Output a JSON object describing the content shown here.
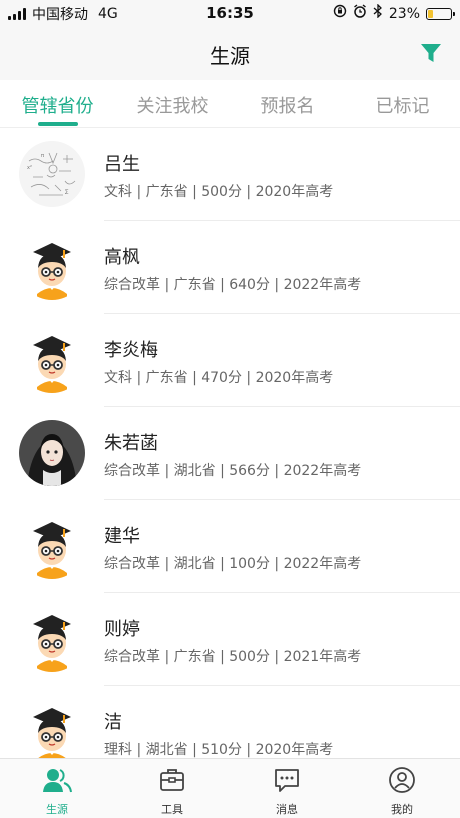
{
  "status_bar": {
    "carrier": "中国移动",
    "network": "4G",
    "time": "16:35",
    "battery_text": "23%",
    "battery_level": 0.23,
    "icons": [
      "rotation-lock-icon",
      "alarm-icon",
      "bluetooth-icon"
    ]
  },
  "nav": {
    "title": "生源",
    "filter_icon": "filter-icon"
  },
  "tabs": [
    {
      "label": "管辖省份",
      "active": true
    },
    {
      "label": "关注我校",
      "active": false
    },
    {
      "label": "预报名",
      "active": false
    },
    {
      "label": "已标记",
      "active": false
    }
  ],
  "students": [
    {
      "name": "吕生",
      "meta": "文科 | 广东省 | 500分 | 2020年高考",
      "avatar": "sketch-photo"
    },
    {
      "name": "高枫",
      "meta": "综合改革 | 广东省 | 640分 | 2022年高考",
      "avatar": "graduate-cartoon"
    },
    {
      "name": "李炎梅",
      "meta": "文科 | 广东省 | 470分 | 2020年高考",
      "avatar": "graduate-cartoon"
    },
    {
      "name": "朱若菡",
      "meta": "综合改革 | 湖北省 | 566分 | 2022年高考",
      "avatar": "girl-illustration"
    },
    {
      "name": "建华",
      "meta": "综合改革 | 湖北省 | 100分 | 2022年高考",
      "avatar": "graduate-cartoon"
    },
    {
      "name": "则婷",
      "meta": "综合改革 | 广东省 | 500分 | 2021年高考",
      "avatar": "graduate-cartoon"
    },
    {
      "name": "洁",
      "meta": "理科 | 湖北省 | 510分 | 2020年高考",
      "avatar": "graduate-cartoon"
    }
  ],
  "tabbar": [
    {
      "label": "生源",
      "icon": "students-icon",
      "active": true
    },
    {
      "label": "工具",
      "icon": "toolbox-icon",
      "active": false
    },
    {
      "label": "消息",
      "icon": "message-icon",
      "active": false
    },
    {
      "label": "我的",
      "icon": "profile-icon",
      "active": false
    }
  ],
  "colors": {
    "accent": "#1fae8c",
    "inactive_tab": "#999999",
    "meta_text": "#666666"
  }
}
